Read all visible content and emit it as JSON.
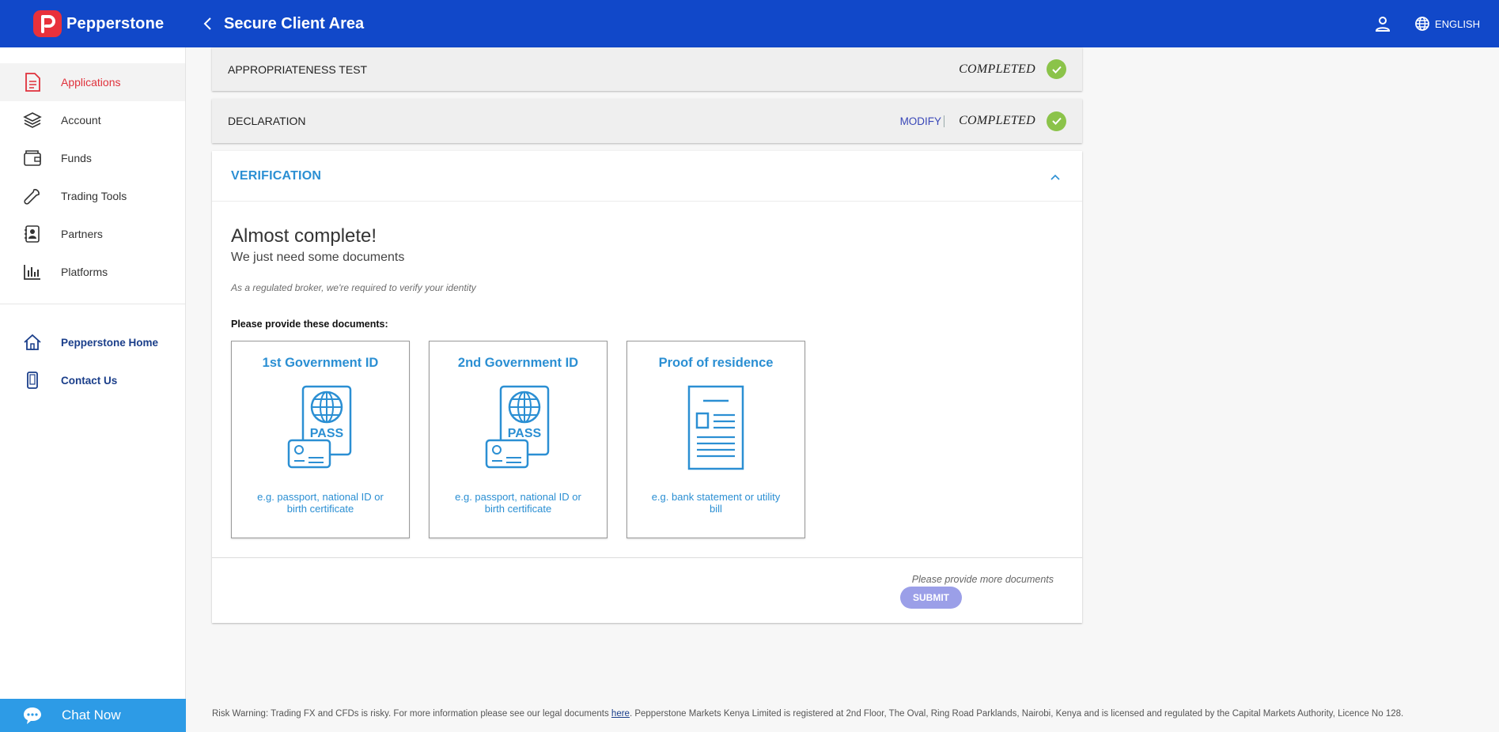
{
  "header": {
    "brand": "Pepperstone",
    "title": "Secure Client Area",
    "language": "ENGLISH",
    "color": "#1148c9"
  },
  "sidebar": {
    "items": [
      {
        "label": "Applications",
        "icon": "document-icon",
        "active": true
      },
      {
        "label": "Account",
        "icon": "layers-icon"
      },
      {
        "label": "Funds",
        "icon": "wallet-icon"
      },
      {
        "label": "Trading Tools",
        "icon": "wrench-icon"
      },
      {
        "label": "Partners",
        "icon": "partners-icon"
      },
      {
        "label": "Platforms",
        "icon": "bar-chart-icon"
      }
    ],
    "links": [
      {
        "label": "Pepperstone Home",
        "icon": "home-icon"
      },
      {
        "label": "Contact Us",
        "icon": "phone-icon"
      }
    ],
    "chat": "Chat Now"
  },
  "steps": [
    {
      "label": "APPROPRIATENESS TEST",
      "status": "COMPLETED"
    },
    {
      "label": "DECLARATION",
      "modify": "MODIFY",
      "status": "COMPLETED"
    }
  ],
  "verification": {
    "title": "VERIFICATION",
    "heading": "Almost complete!",
    "subheading": "We just need some documents",
    "note": "As a regulated broker, we're required to verify your identity",
    "docs_label": "Please provide these documents:",
    "documents": [
      {
        "title": "1st Government ID",
        "icon": "passport-icon",
        "desc": "e.g. passport, national ID or birth certificate"
      },
      {
        "title": "2nd Government ID",
        "icon": "passport-icon",
        "desc": "e.g. passport, national ID or birth certificate"
      },
      {
        "title": "Proof of residence",
        "icon": "document-icon",
        "desc": "e.g. bank statement or utility bill"
      }
    ],
    "pass_text": "PASS",
    "footer_note": "Please provide more documents",
    "submit": "SUBMIT"
  },
  "footer": {
    "text_before": "Risk Warning: Trading FX and CFDs is risky. For more information please see our legal documents ",
    "link": "here",
    "text_after": ". Pepperstone Markets Kenya Limited is registered at 2nd Floor, The Oval, Ring Road Parklands, Nairobi, Kenya and is licensed and regulated by the Capital Markets Authority, Licence No 128."
  }
}
